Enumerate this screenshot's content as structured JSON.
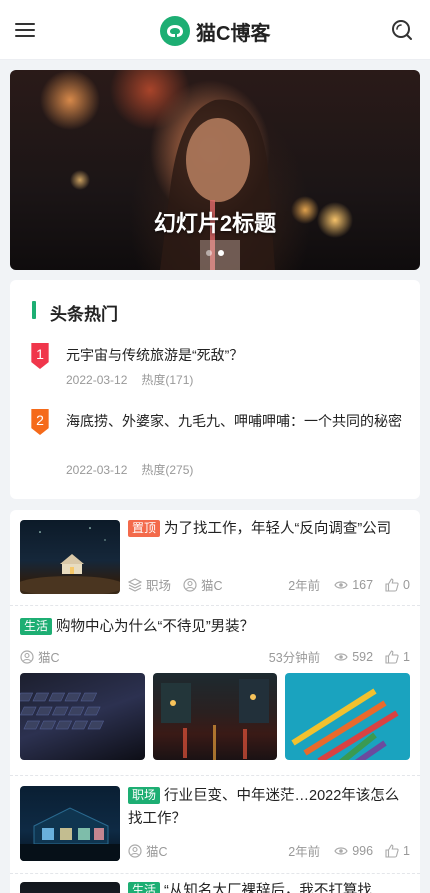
{
  "header": {
    "brand": "猫C博客"
  },
  "slider": {
    "title": "幻灯片2标题",
    "dots": 2,
    "active_dot": 1
  },
  "hot": {
    "heading": "头条热门",
    "items": [
      {
        "rank": "1",
        "title": "元宇宙与传统旅游是“死敌”？",
        "date": "2022-03-12",
        "heat": "热度(171)",
        "color": "#f0364b"
      },
      {
        "rank": "2",
        "title": "海底捞、外婆家、九毛九、呷哺呷哺：一个共同的秘密",
        "date": "2022-03-12",
        "heat": "热度(275)",
        "color": "#f56a1a"
      }
    ]
  },
  "articles": [
    {
      "tag": "置顶",
      "title": "为了找工作，年轻人“反向调查”公司",
      "category": "职场",
      "author": "猫C",
      "time": "2年前",
      "views": "167",
      "likes": "0"
    },
    {
      "tag": "生活",
      "title": "购物中心为什么“不待见”男装？",
      "author": "猫C",
      "time": "53分钟前",
      "views": "592",
      "likes": "1"
    },
    {
      "tag": "职场",
      "title": "行业巨变、中年迷茫…2022年该怎么找工作？",
      "author": "猫C",
      "time": "2年前",
      "views": "996",
      "likes": "1"
    },
    {
      "tag": "生活",
      "title": "“从知名大厂裸辞后，我不打算找"
    }
  ],
  "colors": {
    "accent": "#1dae73",
    "top_tag": "#f36a4b"
  }
}
